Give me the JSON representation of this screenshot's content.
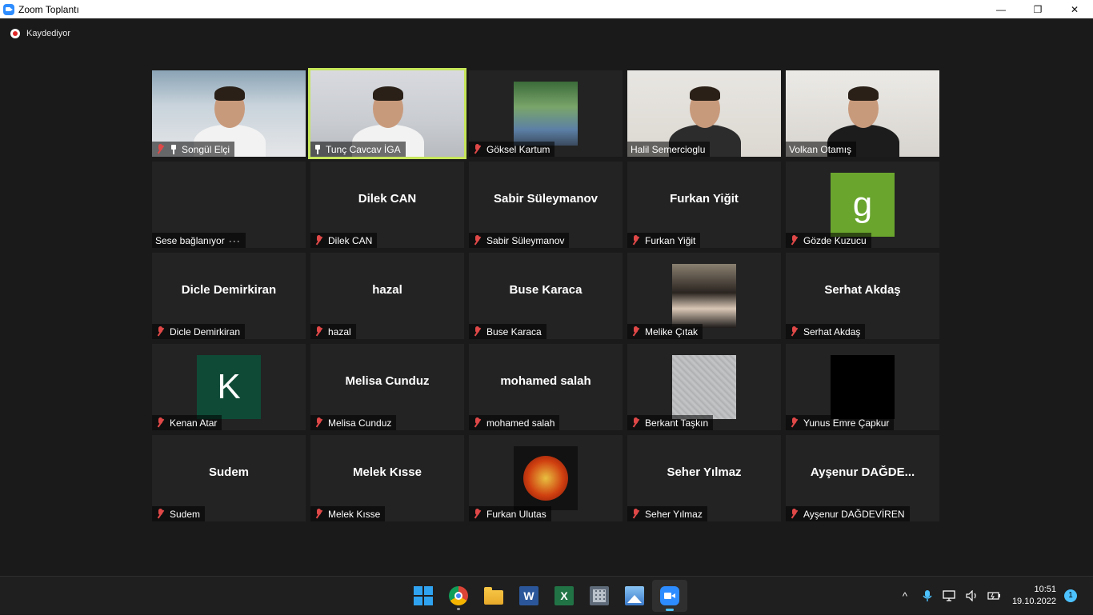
{
  "window": {
    "title": "Zoom Toplantı",
    "minimize_glyph": "—",
    "maximize_glyph": "❐",
    "close_glyph": "✕"
  },
  "recording": {
    "label": "Kaydediyor",
    "icon": "record-icon"
  },
  "participants": [
    {
      "name": "Songül Elçi",
      "display": "",
      "muted": true,
      "pinned": true,
      "video": "v1"
    },
    {
      "name": "Tunç Cavcav İGA",
      "display": "",
      "muted": false,
      "pinned": true,
      "video": "v2",
      "speaking": true
    },
    {
      "name": "Göksel Kartum",
      "display": "",
      "muted": true,
      "avatar": "photo"
    },
    {
      "name": "Halil Semercioglu",
      "display": "",
      "muted": false,
      "video": "v4"
    },
    {
      "name": "Volkan Otamış",
      "display": "",
      "muted": false,
      "video": "v5"
    },
    {
      "name": "Sese bağlanıyor",
      "display": "",
      "muted": false,
      "connecting": true,
      "dots": "···"
    },
    {
      "name": "Dilek CAN",
      "display": "Dilek CAN",
      "muted": true
    },
    {
      "name": "Sabir Süleymanov",
      "display": "Sabir Süleymanov",
      "muted": true
    },
    {
      "name": "Furkan Yiğit",
      "display": "Furkan Yiğit",
      "muted": true
    },
    {
      "name": "Gözde Kuzucu",
      "display": "",
      "muted": true,
      "avatar_letter": "g",
      "avatar_color": "#6aa52e"
    },
    {
      "name": "Dicle Demirkiran",
      "display": "Dicle Demirkiran",
      "muted": true
    },
    {
      "name": "hazal",
      "display": "hazal",
      "muted": true
    },
    {
      "name": "Buse Karaca",
      "display": "Buse Karaca",
      "muted": true
    },
    {
      "name": "Melike Çıtak",
      "display": "",
      "muted": true,
      "avatar": "photo"
    },
    {
      "name": "Serhat Akdaş",
      "display": "Serhat Akdaş",
      "muted": true
    },
    {
      "name": "Kenan Atar",
      "display": "",
      "muted": true,
      "avatar_letter": "K",
      "avatar_color": "#0f4a36"
    },
    {
      "name": "Melisa Cunduz",
      "display": "Melisa Cunduz",
      "muted": true
    },
    {
      "name": "mohamed salah",
      "display": "mohamed salah",
      "muted": true
    },
    {
      "name": "Berkant Taşkın",
      "display": "",
      "muted": true,
      "avatar": "grey"
    },
    {
      "name": "Yunus Emre Çapkur",
      "display": "",
      "muted": true,
      "avatar": "black"
    },
    {
      "name": "Sudem",
      "display": "Sudem",
      "muted": true
    },
    {
      "name": "Melek Kısse",
      "display": "Melek Kısse",
      "muted": true
    },
    {
      "name": "Furkan Ulutas",
      "display": "",
      "muted": true,
      "avatar": "flash"
    },
    {
      "name": "Seher Yılmaz",
      "display": "Seher Yılmaz",
      "muted": true
    },
    {
      "name": "Ayşenur DAĞDEVİREN",
      "display": "Ayşenur  DAĞDE...",
      "muted": true
    }
  ],
  "taskbar": {
    "apps": [
      {
        "name": "start",
        "icon": "windows-start-icon"
      },
      {
        "name": "chrome",
        "icon": "chrome-icon",
        "running": true
      },
      {
        "name": "file-explorer",
        "icon": "folder-icon"
      },
      {
        "name": "word",
        "icon": "word-icon",
        "glyph": "W"
      },
      {
        "name": "excel",
        "icon": "excel-icon",
        "glyph": "X"
      },
      {
        "name": "calculator",
        "icon": "calculator-icon"
      },
      {
        "name": "photos",
        "icon": "photos-icon"
      },
      {
        "name": "zoom",
        "icon": "zoom-icon",
        "active": true
      }
    ],
    "tray": {
      "chevron": "^",
      "time": "10:51",
      "date": "19.10.2022",
      "notifications": "1"
    }
  }
}
